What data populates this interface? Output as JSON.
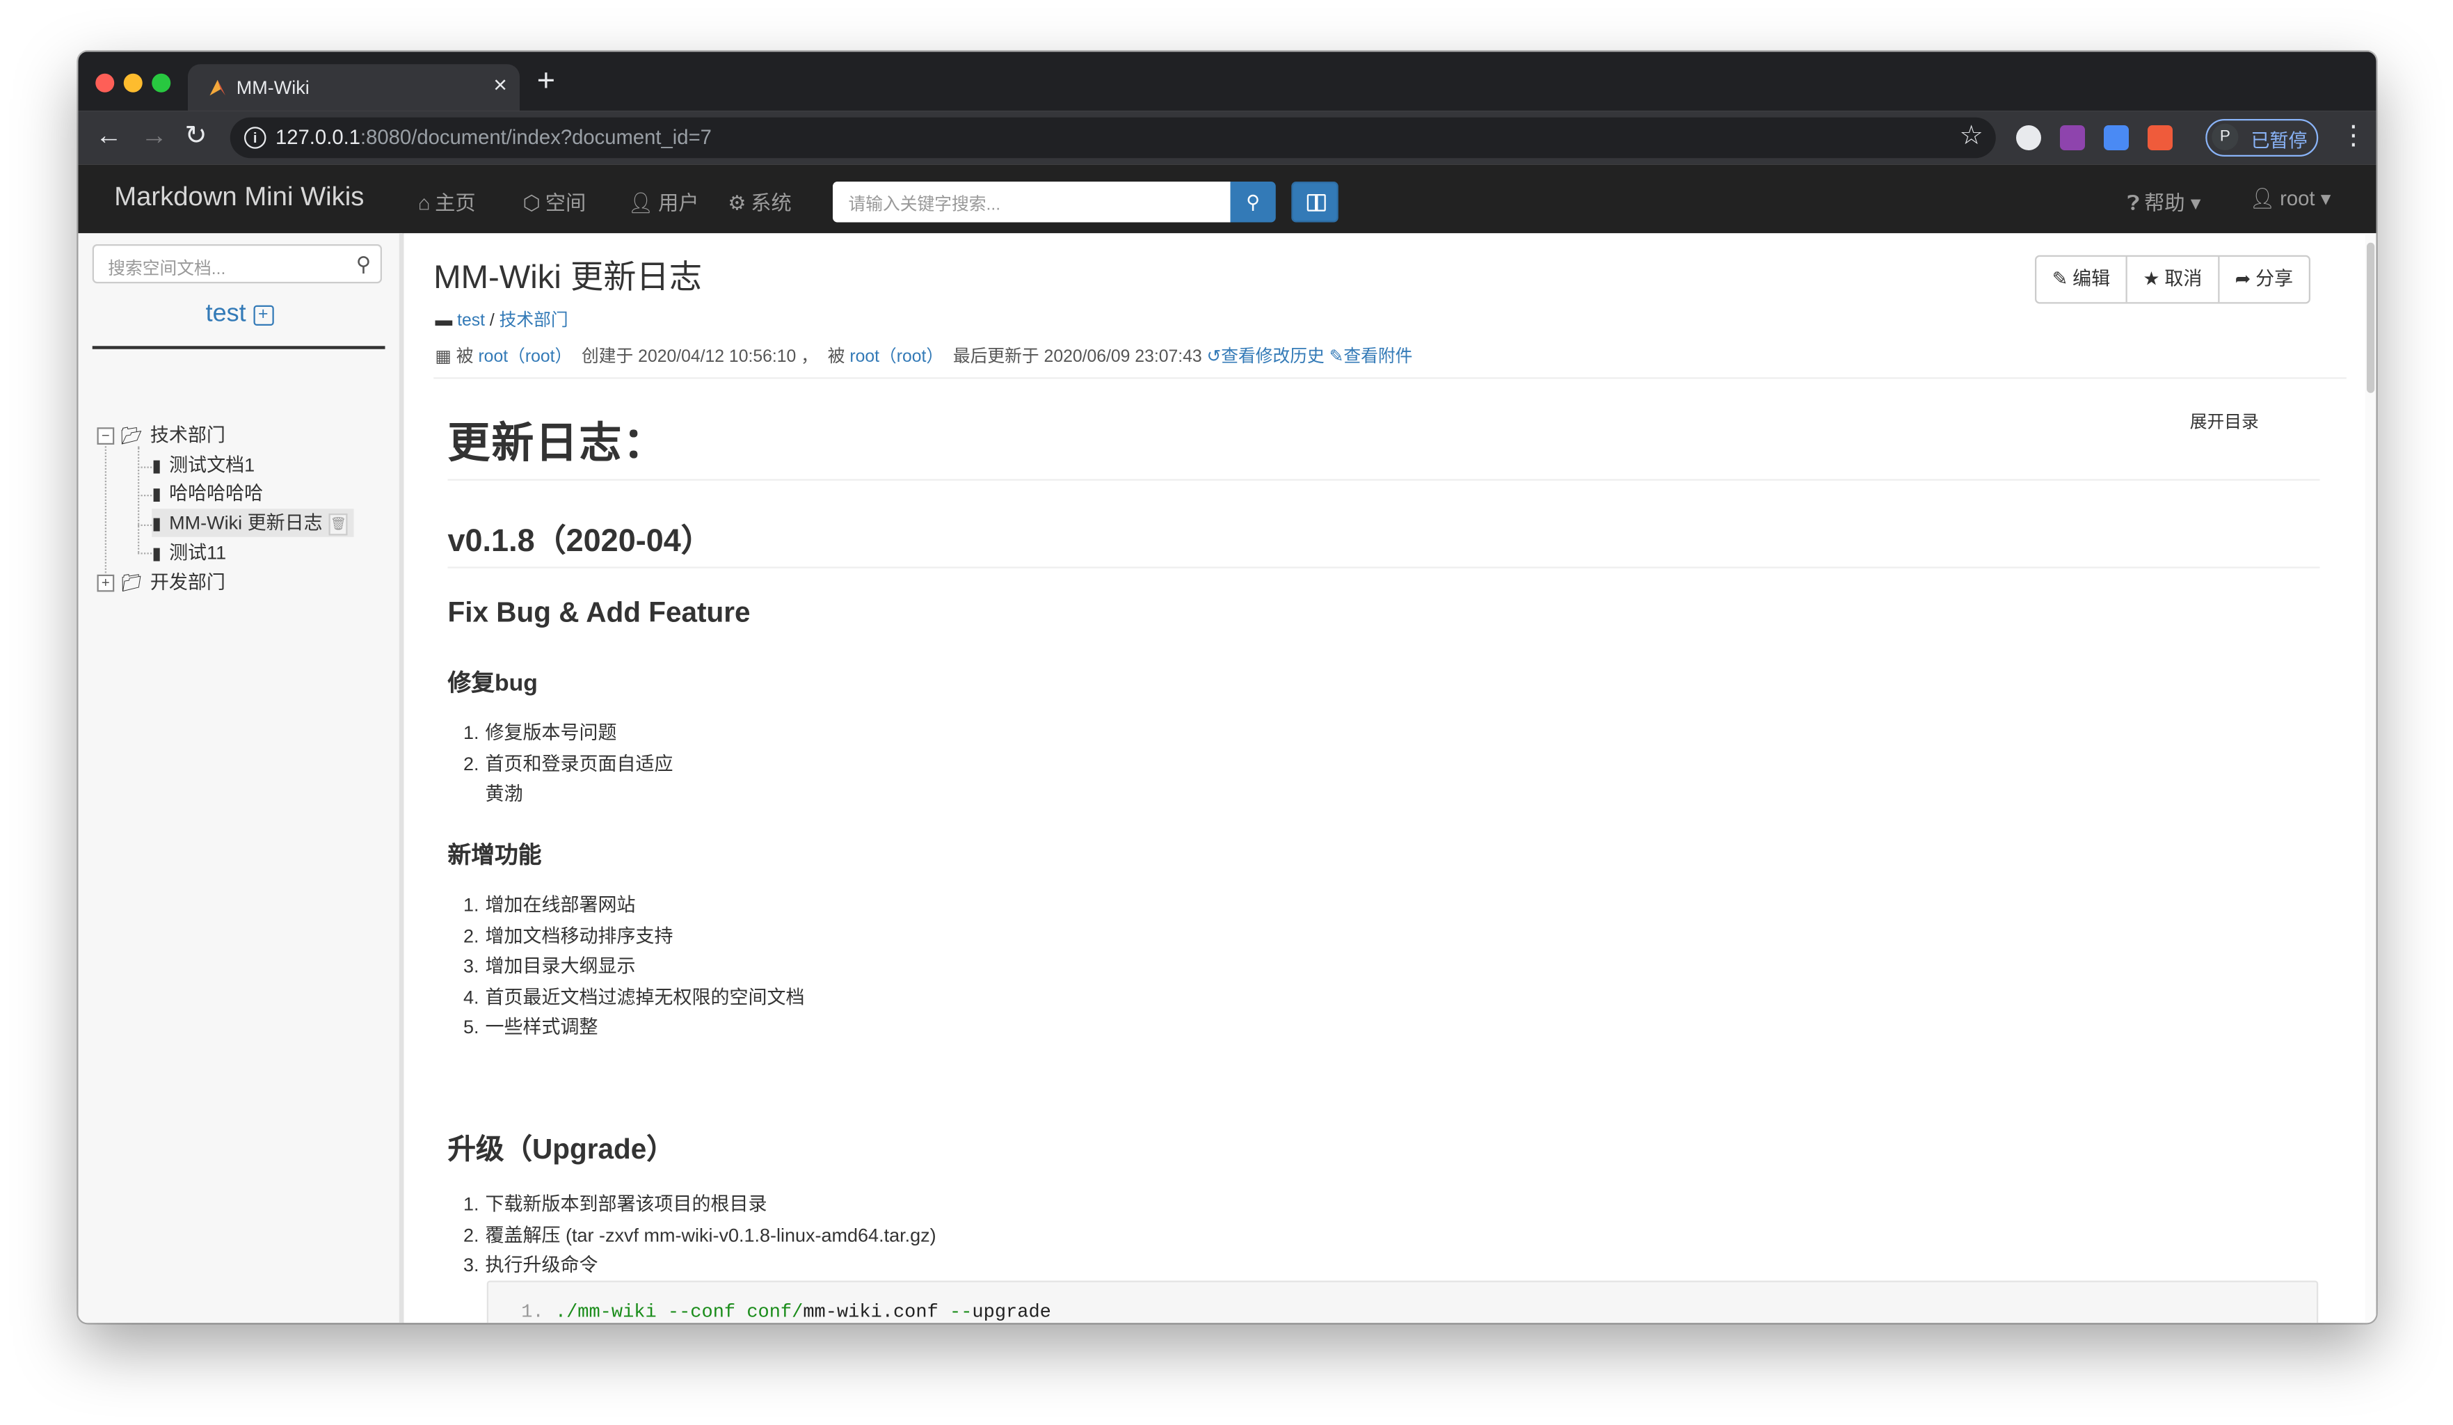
{
  "browser": {
    "tab_title": "MM-Wiki",
    "url_host": "127.0.0.1",
    "url_rest": ":8080/document/index?document_id=7",
    "profile_initial": "P",
    "profile_status": "已暂停"
  },
  "navbar": {
    "brand": "Markdown Mini Wikis",
    "items": [
      "主页",
      "空间",
      "用户",
      "系统"
    ],
    "search_placeholder": "请输入关键字搜索...",
    "help": "帮助",
    "user": "root"
  },
  "sidebar": {
    "search_placeholder": "搜索空间文档...",
    "space_name": "test",
    "tree": [
      {
        "label": "技术部门",
        "type": "folder-open"
      },
      {
        "label": "测试文档1",
        "type": "file"
      },
      {
        "label": "哈哈哈哈哈",
        "type": "file"
      },
      {
        "label": "MM-Wiki 更新日志",
        "type": "file",
        "selected": true
      },
      {
        "label": "测试11",
        "type": "file"
      },
      {
        "label": "开发部门",
        "type": "folder"
      }
    ]
  },
  "doc": {
    "title": "MM-Wiki 更新日志",
    "buttons": [
      "编辑",
      "取消",
      "分享"
    ],
    "breadcrumb": [
      "test",
      "技术部门"
    ],
    "meta": {
      "by": "被",
      "creator": "root（root）",
      "created": "创建于 2020/04/12 10:56:10 ，",
      "by2": "被",
      "editor": "root（root）",
      "updated": "最后更新于 2020/06/09 23:07:43",
      "history": "查看修改历史",
      "attachments": "查看附件"
    },
    "toc_link": "展开目录"
  },
  "content": {
    "h1": "更新日志：",
    "h2": "v0.1.8（2020-04）",
    "h3": "Fix Bug & Add Feature",
    "fix_title": "修复bug",
    "fix_items": [
      "修复版本号问题",
      "首页和登录页面自适应",
      "黄渤"
    ],
    "feature_title": "新增功能",
    "feature_items": [
      "增加在线部署网站",
      "增加文档移动排序支持",
      "增加目录大纲显示",
      "首页最近文档过滤掉无权限的空间文档",
      "一些样式调整"
    ],
    "upgrade_title": "升级（Upgrade）",
    "upgrade_items": [
      "下载新版本到部署该项目的根目录",
      "覆盖解压 (tar -zxvf mm-wiki-v0.1.8-linux-amd64.tar.gz)",
      "执行升级命令"
    ],
    "code": {
      "line_no": "1.",
      "prefix": "./mm-wiki",
      "flag1": " --conf ",
      "path": "conf/",
      "file": "mm-wiki.conf",
      "flag2": " --",
      "arg": "upgrade"
    }
  },
  "colors": {
    "navbar_bg": "#222222",
    "link": "#337ab7",
    "primary_button": "#337ab7",
    "code_green": "#1a8c1a"
  },
  "icons": [
    "home-icon",
    "cube-icon",
    "user-icon",
    "cog-icon",
    "search-icon",
    "columns-icon",
    "question-icon",
    "caret-down-icon",
    "folder-icon",
    "file-icon",
    "pencil-icon",
    "star-icon",
    "share-icon",
    "calendar-icon",
    "history-icon",
    "paperclip-icon"
  ]
}
